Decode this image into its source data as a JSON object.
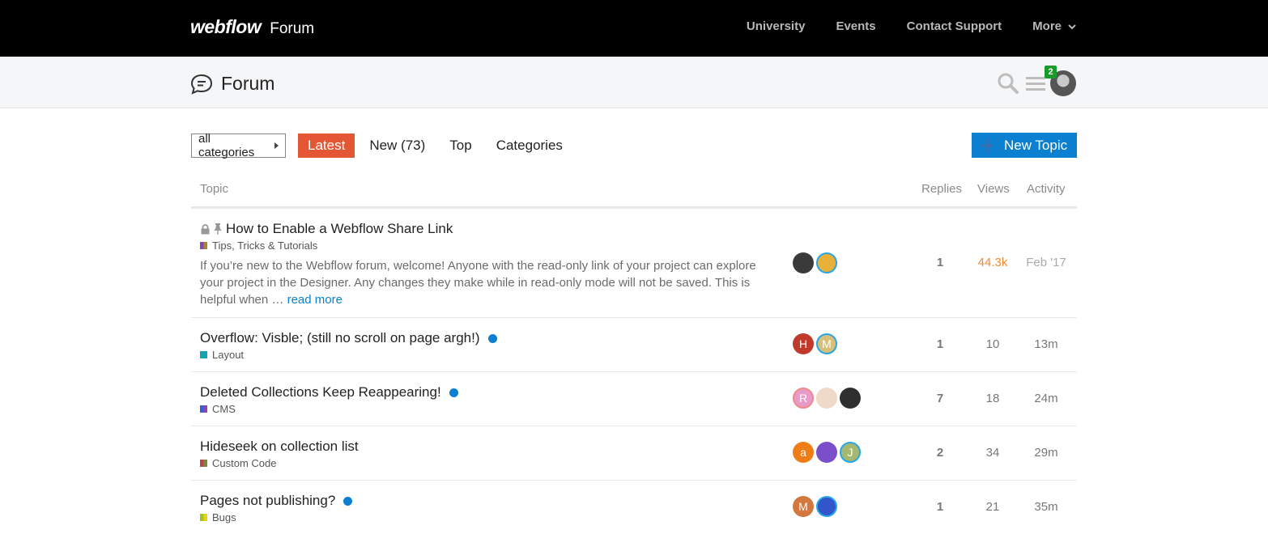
{
  "header": {
    "logo": "webflow",
    "forum_label": "Forum",
    "nav": [
      "University",
      "Events",
      "Contact Support",
      "More"
    ]
  },
  "subheader": {
    "title": "Forum",
    "notification_count": "2"
  },
  "controls": {
    "category_dropdown": "all categories",
    "tabs": [
      {
        "label": "Latest",
        "active": true
      },
      {
        "label": "New (73)",
        "active": false
      },
      {
        "label": "Top",
        "active": false
      },
      {
        "label": "Categories",
        "active": false
      }
    ],
    "new_topic": "New Topic"
  },
  "table": {
    "headers": {
      "topic": "Topic",
      "replies": "Replies",
      "views": "Views",
      "activity": "Activity"
    },
    "rows": [
      {
        "title": "How to Enable a Webflow Share Link",
        "locked": true,
        "pinned": true,
        "category": "Tips, Tricks & Tutorials",
        "category_colors": [
          "#8e44ad",
          "#a3882e"
        ],
        "excerpt": "If you’re new to the Webflow forum, welcome! Anyone with the read-only link of your project can explore your project in the Designer. Any changes they make while in read-only mode will not be saved. This is helpful when …",
        "read_more": "read more",
        "avatars": [
          {
            "letter": "",
            "color": "#3a3a3a",
            "ring": "none"
          },
          {
            "letter": "",
            "color": "#e8b13a",
            "ring": "blue"
          }
        ],
        "replies": "1",
        "views": "44.3k",
        "activity": "Feb '17",
        "unread": false
      },
      {
        "title": "Overflow: Visble; (still no scroll on page argh!)",
        "category": "Layout",
        "category_colors": [
          "#12a5b0",
          "#12a5b0"
        ],
        "avatars": [
          {
            "letter": "H",
            "color": "#c0392b",
            "ring": "none"
          },
          {
            "letter": "M",
            "color": "#d8c07a",
            "ring": "blue"
          }
        ],
        "replies": "1",
        "views": "10",
        "activity": "13m",
        "unread": true
      },
      {
        "title": "Deleted Collections Keep Reappearing!",
        "category": "CMS",
        "category_colors": [
          "#3d5bd8",
          "#8e44ad"
        ],
        "avatars": [
          {
            "letter": "R",
            "color": "#e89ac8",
            "ring": "red"
          },
          {
            "letter": "",
            "color": "#efd9c9",
            "ring": "none"
          },
          {
            "letter": "",
            "color": "#2f2f2f",
            "ring": "none"
          }
        ],
        "replies": "7",
        "views": "18",
        "activity": "24m",
        "unread": true
      },
      {
        "title": "Hideseek on collection list",
        "category": "Custom Code",
        "category_colors": [
          "#b5484f",
          "#7a8a3a"
        ],
        "avatars": [
          {
            "letter": "a",
            "color": "#ef7d16",
            "ring": "none"
          },
          {
            "letter": "",
            "color": "#7b4fc9",
            "ring": "none"
          },
          {
            "letter": "J",
            "color": "#a6b870",
            "ring": "blue"
          }
        ],
        "replies": "2",
        "views": "34",
        "activity": "29m",
        "unread": false
      },
      {
        "title": "Pages not publishing?",
        "category": "Bugs",
        "category_colors": [
          "#a3c41a",
          "#e8d21a"
        ],
        "avatars": [
          {
            "letter": "M",
            "color": "#d2783e",
            "ring": "none"
          },
          {
            "letter": "",
            "color": "#3355cc",
            "ring": "blue"
          }
        ],
        "replies": "1",
        "views": "21",
        "activity": "35m",
        "unread": true
      }
    ]
  }
}
